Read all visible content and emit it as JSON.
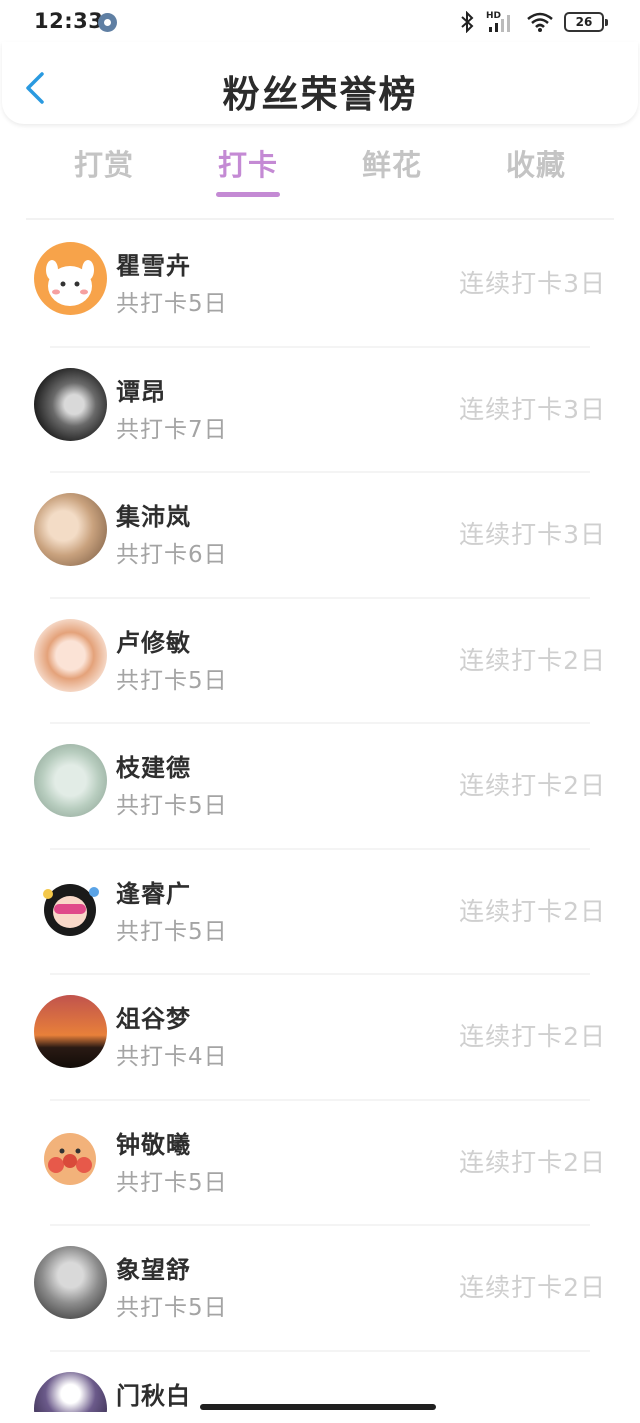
{
  "status_bar": {
    "time": "12:33",
    "network": "HD",
    "battery": "26",
    "icons": [
      "gear-icon",
      "bluetooth-icon",
      "signal-icon",
      "wifi-icon",
      "battery-icon"
    ]
  },
  "header": {
    "title": "粉丝荣誉榜",
    "back_icon": "chevron-left-icon"
  },
  "tabs": {
    "active_index": 1,
    "items": [
      {
        "label": "打赏"
      },
      {
        "label": "打卡"
      },
      {
        "label": "鲜花"
      },
      {
        "label": "收藏"
      }
    ]
  },
  "colors": {
    "accent": "#c48ad4",
    "back_icon": "#2a9ae0",
    "inactive_tab": "#c4c4c4",
    "secondary_text": "#a4a4a4",
    "streak_text": "#cfcfcf"
  },
  "fans": [
    {
      "name": "瞿雪卉",
      "total": "共打卡5日",
      "streak": "连续打卡3日",
      "avatar": "cartoon-dog-avatar"
    },
    {
      "name": "谭昂",
      "total": "共打卡7日",
      "streak": "连续打卡3日",
      "avatar": "bw-portrait-avatar"
    },
    {
      "name": "集沛岚",
      "total": "共打卡6日",
      "streak": "连续打卡3日",
      "avatar": "photo-avatar"
    },
    {
      "name": "卢修敏",
      "total": "共打卡5日",
      "streak": "连续打卡2日",
      "avatar": "anime-girl-avatar"
    },
    {
      "name": "枝建德",
      "total": "共打卡5日",
      "streak": "连续打卡2日",
      "avatar": "photo-avatar"
    },
    {
      "name": "逢睿广",
      "total": "共打卡5日",
      "streak": "连续打卡2日",
      "avatar": "cartoon-girl-avatar"
    },
    {
      "name": "俎谷梦",
      "total": "共打卡4日",
      "streak": "连续打卡2日",
      "avatar": "sunset-avatar"
    },
    {
      "name": "钟敬曦",
      "total": "共打卡5日",
      "streak": "连续打卡2日",
      "avatar": "cartoon-face-avatar"
    },
    {
      "name": "象望舒",
      "total": "共打卡5日",
      "streak": "连续打卡2日",
      "avatar": "portrait-avatar"
    },
    {
      "name": "门秋白",
      "total": "",
      "streak": "",
      "avatar": "partial-avatar"
    }
  ]
}
